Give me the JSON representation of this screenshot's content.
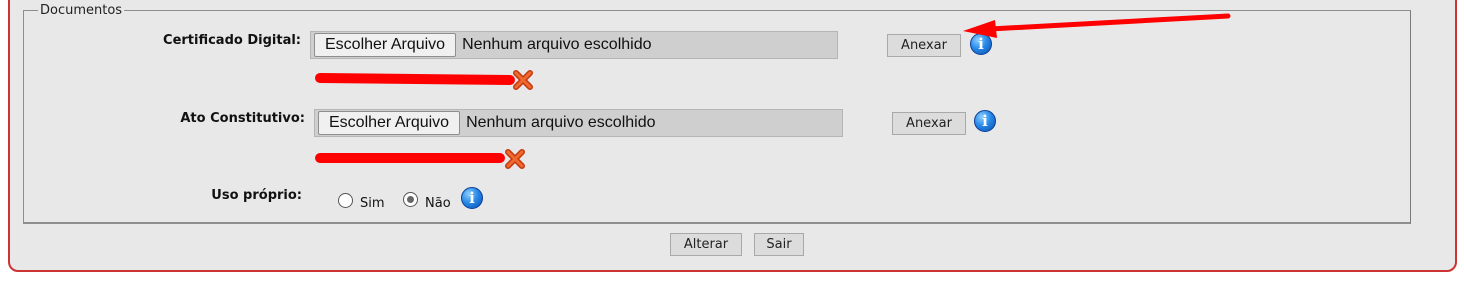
{
  "documentos": {
    "legend": "Documentos",
    "certificado": {
      "label": "Certificado Digital:",
      "choose_label": "Escolher Arquivo",
      "file_status": "Nenhum arquivo escolhido",
      "attach_label": "Anexar",
      "info_glyph": "i"
    },
    "ato": {
      "label": "Ato Constitutivo:",
      "choose_label": "Escolher Arquivo",
      "file_status": "Nenhum arquivo escolhido",
      "attach_label": "Anexar",
      "info_glyph": "i"
    },
    "uso": {
      "label": "Uso próprio:",
      "options": [
        "Sim",
        "Não"
      ],
      "selected": "Não",
      "info_glyph": "i"
    }
  },
  "actions": {
    "alterar_label": "Alterar",
    "sair_label": "Sair"
  },
  "colors": {
    "panel_border": "#cc3333",
    "panel_bg": "#e8e8e8",
    "annotation_red": "#ff0000",
    "info_blue": "#2a8ae8"
  },
  "icons": {
    "info": "info-icon",
    "remove": "close-x-icon",
    "arrow": "red-arrow-annotation"
  }
}
